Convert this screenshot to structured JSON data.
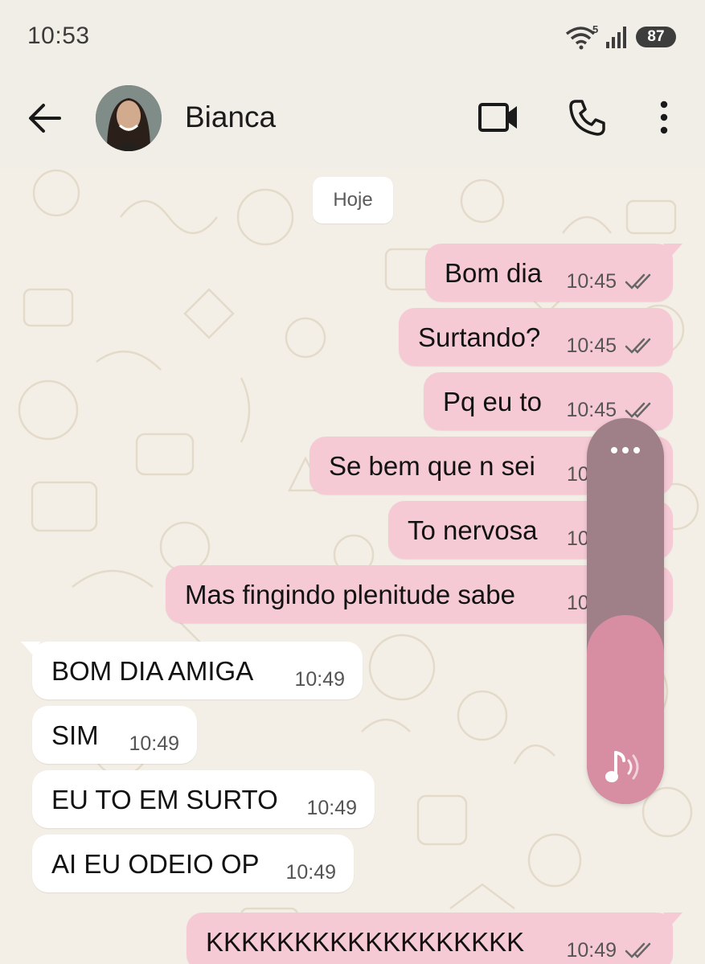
{
  "status_bar": {
    "time": "10:53",
    "wifi_badge": "5",
    "battery": "87",
    "icons": [
      "wifi-icon",
      "signal-icon",
      "battery-icon"
    ]
  },
  "header": {
    "back_icon": "arrow-left-icon",
    "contact_name": "Bianca",
    "actions": [
      "video-call-icon",
      "phone-icon",
      "more-vertical-icon"
    ]
  },
  "chat": {
    "date_chip": "Hoje",
    "messages": [
      {
        "dir": "out",
        "text": "Bom dia",
        "time": "10:45",
        "read": true
      },
      {
        "dir": "out",
        "text": "Surtando?",
        "time": "10:45",
        "read": true
      },
      {
        "dir": "out",
        "text": "Pq eu to",
        "time": "10:45",
        "read": true
      },
      {
        "dir": "out",
        "text": "Se bem que n sei",
        "time": "10",
        "read": true
      },
      {
        "dir": "out",
        "text": "To nervosa",
        "time": "10",
        "read": true
      },
      {
        "dir": "out",
        "text": "Mas fingindo plenitude sabe",
        "time": "10",
        "read": true
      },
      {
        "dir": "in",
        "text": "BOM DIA AMIGA",
        "time": "10:49"
      },
      {
        "dir": "in",
        "text": "SIM",
        "time": "10:49"
      },
      {
        "dir": "in",
        "text": "EU TO EM SURTO",
        "time": "10:49"
      },
      {
        "dir": "in",
        "text": "AI EU ODEIO OP",
        "time": "10:49"
      },
      {
        "dir": "out",
        "text": "KKKKKKKKKKKKKKKKKK",
        "time": "10:49",
        "read": true
      }
    ]
  },
  "volume_overlay": {
    "level_fraction": 0.49,
    "more_icon": "more-horizontal-icon",
    "media_icon": "music-note-volume-icon"
  },
  "colors": {
    "background": "#f1ede7",
    "outgoing_bubble": "#f6cad5",
    "incoming_bubble": "#ffffff",
    "volume_track": "#9f8088",
    "volume_fill": "#d88ea2"
  }
}
